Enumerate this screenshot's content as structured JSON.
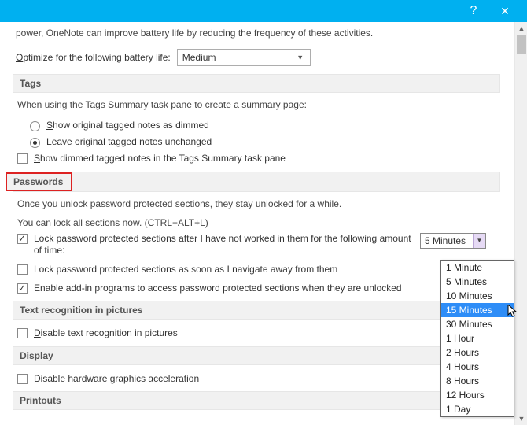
{
  "titlebar": {
    "help": "?",
    "close": "✕"
  },
  "intro_trail": "power, OneNote can improve battery life by reducing the frequency of these activities.",
  "battery": {
    "label_pre": "O",
    "label_rest": "ptimize for the following battery life:",
    "selected": "Medium"
  },
  "sections": {
    "tags": "Tags",
    "passwords": "Passwords",
    "text_recog": "Text recognition in pictures",
    "display": "Display",
    "printouts": "Printouts"
  },
  "tags": {
    "intro": "When using the Tags Summary task pane to create a summary page:",
    "opt_dimmed_pre": "S",
    "opt_dimmed_rest": "how original tagged notes as dimmed",
    "opt_unchanged_pre": "L",
    "opt_unchanged_rest": "eave original tagged notes unchanged",
    "show_dimmed_pre": "S",
    "show_dimmed_rest": "how dimmed tagged notes in the Tags Summary task pane"
  },
  "passwords": {
    "intro": "Once you unlock password protected sections, they stay unlocked for a while.",
    "lock_now": "You can lock all sections now. (CTRL+ALT+L)",
    "lock_timeout": "Lock password protected sections after I have not worked in them for the following amount of time:",
    "lock_nav": "Lock password protected sections as soon as I navigate away from them",
    "enable_addin": "Enable add-in programs to access password protected sections when they are unlocked",
    "timeout_selected": "5 Minutes",
    "timeout_options": [
      "1 Minute",
      "5 Minutes",
      "10 Minutes",
      "15 Minutes",
      "30 Minutes",
      "1 Hour",
      "2 Hours",
      "4 Hours",
      "8 Hours",
      "12 Hours",
      "1 Day"
    ],
    "timeout_hover_index": 3
  },
  "text_recog": {
    "disable_pre": "D",
    "disable_rest": "isable text recognition in pictures"
  },
  "display": {
    "disable_hw": "Disable hardware graphics acceleration"
  }
}
